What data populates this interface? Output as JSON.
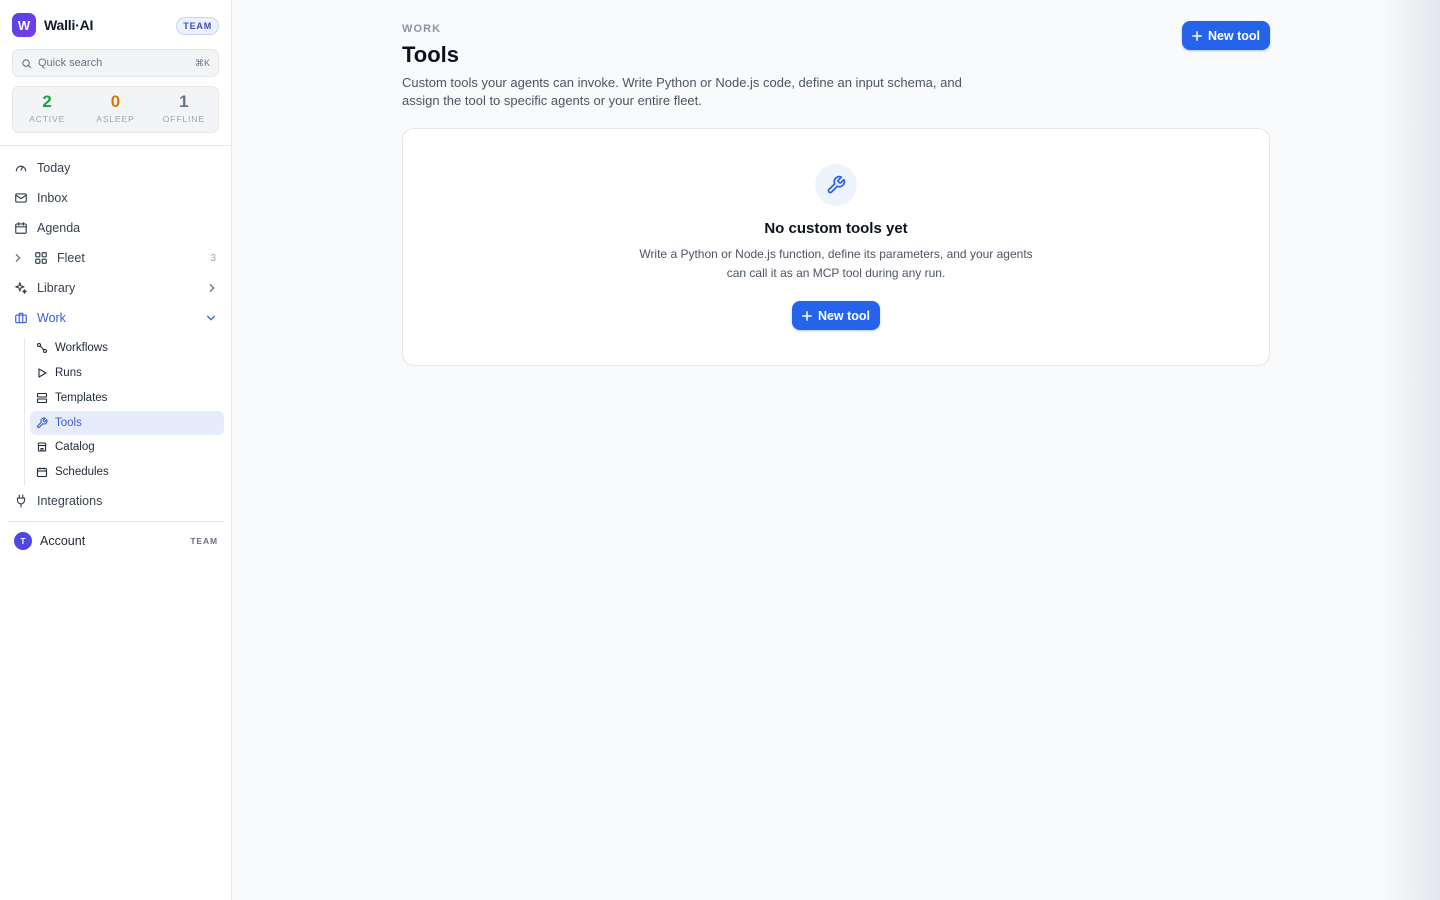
{
  "app": {
    "logo_letter": "W",
    "name": "Walli·AI",
    "plan_badge": "TEAM"
  },
  "search": {
    "placeholder": "Quick search",
    "shortcut": "⌘K"
  },
  "stats": [
    {
      "value": "2",
      "label": "ACTIVE",
      "color": "#16a34a"
    },
    {
      "value": "0",
      "label": "ASLEEP",
      "color": "#d97706"
    },
    {
      "value": "1",
      "label": "OFFLINE",
      "color": "#64748b"
    }
  ],
  "nav": {
    "today": "Today",
    "inbox": "Inbox",
    "agenda": "Agenda",
    "fleet": "Fleet",
    "fleet_count": "3",
    "library": "Library",
    "work": "Work",
    "work_items": [
      "Workflows",
      "Runs",
      "Templates",
      "Tools",
      "Catalog",
      "Schedules"
    ],
    "integrations": "Integrations"
  },
  "account": {
    "avatar_letter": "T",
    "label": "Account",
    "badge": "TEAM"
  },
  "page": {
    "eyebrow": "WORK",
    "title": "Tools",
    "description": "Custom tools your agents can invoke. Write Python or Node.js code, define an input schema, and assign the tool to specific agents or your entire fleet.",
    "new_tool_label": "New tool"
  },
  "empty_state": {
    "icon": "wrench-icon",
    "title": "No custom tools yet",
    "description": "Write a Python or Node.js function, define its parameters, and your agents can call it as an MCP tool during any run.",
    "button_label": "New tool"
  },
  "colors": {
    "accent": "#2563eb",
    "nav_active": "#3b5bdb",
    "active_bg": "#e7ecfb"
  }
}
